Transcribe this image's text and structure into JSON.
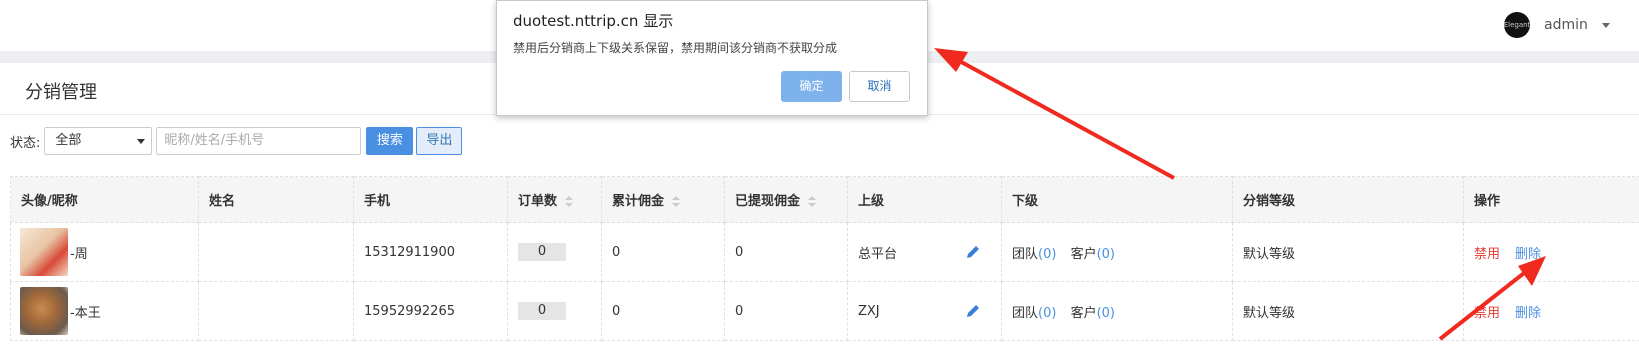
{
  "header": {
    "user_name": "admin",
    "avatar_text": "Elegant"
  },
  "page": {
    "title": "分销管理"
  },
  "filter": {
    "status_label": "状态:",
    "status_value": "全部",
    "search_placeholder": "昵称/姓名/手机号",
    "search_button": "搜索",
    "export_button": "导出"
  },
  "table": {
    "headers": [
      "头像/昵称",
      "姓名",
      "手机",
      "订单数",
      "累计佣金",
      "已提现佣金",
      "上级",
      "下级",
      "分销等级",
      "操作"
    ],
    "rows": [
      {
        "nickname": "-周",
        "name": "",
        "phone": "15312911900",
        "orders": "0",
        "commission": "0",
        "withdrawn": "0",
        "parent": "总平台",
        "team_label": "团队",
        "team_count": "(0)",
        "customer_label": "客户",
        "customer_count": "(0)",
        "level": "默认等级",
        "disable": "禁用",
        "delete": "删除"
      },
      {
        "nickname": "-本王",
        "name": "",
        "phone": "15952992265",
        "orders": "0",
        "commission": "0",
        "withdrawn": "0",
        "parent": "ZXJ",
        "team_label": "团队",
        "team_count": "(0)",
        "customer_label": "客户",
        "customer_count": "(0)",
        "level": "默认等级",
        "disable": "禁用",
        "delete": "删除"
      }
    ]
  },
  "dialog": {
    "title": "duotest.nttrip.cn 显示",
    "message": "禁用后分销商上下级关系保留，禁用期间该分销商不获取分成",
    "ok": "确定",
    "cancel": "取消"
  },
  "colors": {
    "accent": "#4a90e2",
    "danger": "#e53935",
    "annotation": "#f02a1e"
  }
}
